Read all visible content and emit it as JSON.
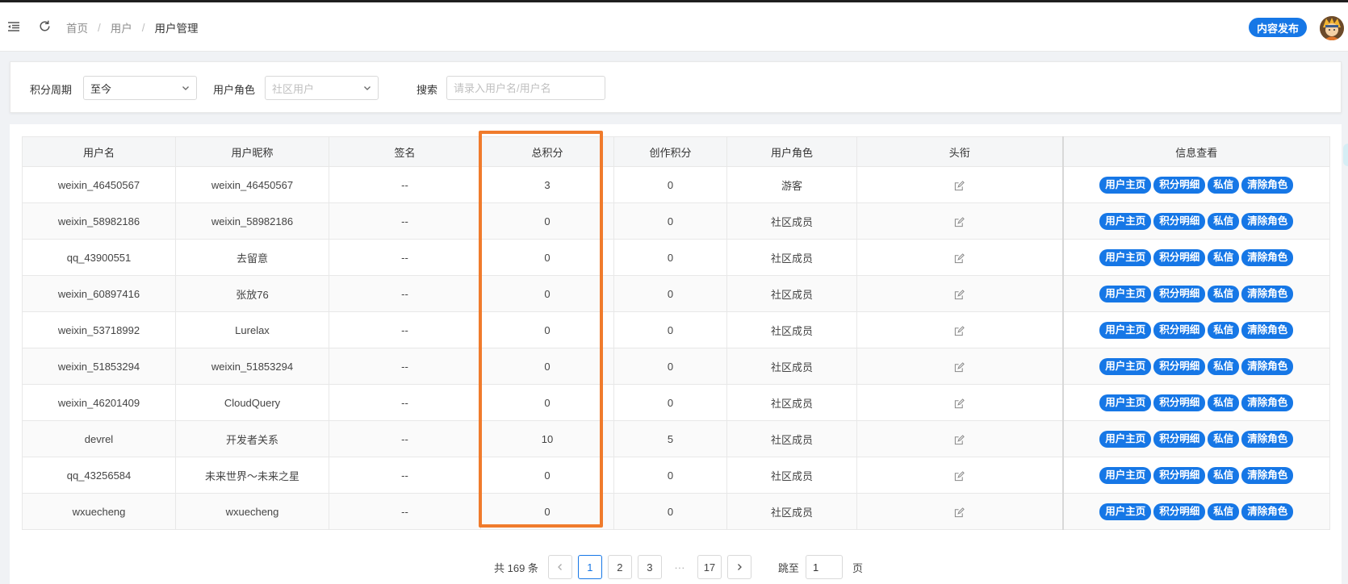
{
  "header": {
    "breadcrumb": [
      "首页",
      "用户",
      "用户管理"
    ],
    "publish_label": "内容发布"
  },
  "filters": {
    "period_label": "积分周期",
    "period_value": "至今",
    "role_label": "用户角色",
    "role_placeholder": "社区用户",
    "search_label": "搜索",
    "search_placeholder": "请录入用户名/用户名"
  },
  "table": {
    "columns": [
      "用户名",
      "用户昵称",
      "签名",
      "总积分",
      "创作积分",
      "用户角色",
      "头衔",
      "信息查看"
    ],
    "actions": [
      "用户主页",
      "积分明细",
      "私信",
      "清除角色"
    ],
    "rows": [
      {
        "username": "weixin_46450567",
        "nickname": "weixin_46450567",
        "signature": "--",
        "total": "3",
        "creation": "0",
        "role": "游客"
      },
      {
        "username": "weixin_58982186",
        "nickname": "weixin_58982186",
        "signature": "--",
        "total": "0",
        "creation": "0",
        "role": "社区成员"
      },
      {
        "username": "qq_43900551",
        "nickname": "去留意",
        "signature": "--",
        "total": "0",
        "creation": "0",
        "role": "社区成员"
      },
      {
        "username": "weixin_60897416",
        "nickname": "张放76",
        "signature": "--",
        "total": "0",
        "creation": "0",
        "role": "社区成员"
      },
      {
        "username": "weixin_53718992",
        "nickname": "Lurelax",
        "signature": "--",
        "total": "0",
        "creation": "0",
        "role": "社区成员"
      },
      {
        "username": "weixin_51853294",
        "nickname": "weixin_51853294",
        "signature": "--",
        "total": "0",
        "creation": "0",
        "role": "社区成员"
      },
      {
        "username": "weixin_46201409",
        "nickname": "CloudQuery",
        "signature": "--",
        "total": "0",
        "creation": "0",
        "role": "社区成员"
      },
      {
        "username": "devrel",
        "nickname": "开发者关系",
        "signature": "--",
        "total": "10",
        "creation": "5",
        "role": "社区成员"
      },
      {
        "username": "qq_43256584",
        "nickname": "未来世界〜未来之星",
        "signature": "--",
        "total": "0",
        "creation": "0",
        "role": "社区成员"
      },
      {
        "username": "wxuecheng",
        "nickname": "wxuecheng",
        "signature": "--",
        "total": "0",
        "creation": "0",
        "role": "社区成员"
      }
    ]
  },
  "pagination": {
    "total_text": "共 169 条",
    "pages": [
      "1",
      "2",
      "3"
    ],
    "ellipsis": "···",
    "last_page": "17",
    "current": "1",
    "jump_label": "跳至",
    "jump_value": "1",
    "unit_label": "页"
  },
  "colors": {
    "accent": "#1677e6",
    "highlight": "#f07b2c"
  }
}
